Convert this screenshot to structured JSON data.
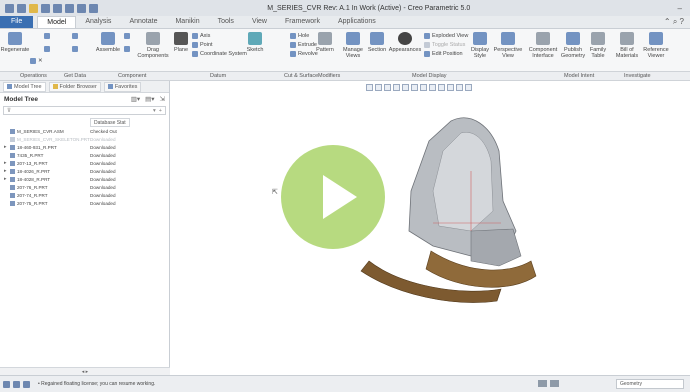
{
  "window": {
    "title": "M_SERIES_CVR Rev: A.1 In Work (Active) - Creo Parametric 5.0"
  },
  "tabs": [
    {
      "label": "File"
    },
    {
      "label": "Model"
    },
    {
      "label": "Analysis"
    },
    {
      "label": "Annotate"
    },
    {
      "label": "Manikin"
    },
    {
      "label": "Tools"
    },
    {
      "label": "View"
    },
    {
      "label": "Framework"
    },
    {
      "label": "Applications"
    }
  ],
  "ribbon": {
    "regenerate": "Regenerate",
    "assemble": "Assemble",
    "drag": "Drag Components",
    "plane": "Plane",
    "axis": "Axis",
    "point": "Point",
    "csys": "Coordinate System",
    "sketch": "Sketch",
    "hole": "Hole",
    "extrude": "Extrude",
    "revolve": "Revolve",
    "pattern": "Pattern",
    "manage_views": "Manage Views",
    "section": "Section",
    "appearances": "Appearances",
    "exploded_view": "Exploded View",
    "toggle_status": "Toggle Status",
    "edit_position": "Edit Position",
    "display_style": "Display Style",
    "perspective_view": "Perspective View",
    "component_interface": "Component Interface",
    "publish_geometry": "Publish Geometry",
    "family_table": "Family Table",
    "bill_of_materials": "Bill of Materials",
    "reference_viewer": "Reference Viewer"
  },
  "groups": {
    "operations": "Operations",
    "get_data": "Get Data",
    "component": "Component",
    "datum": "Datum",
    "cut_surface": "Cut & Surface",
    "modifiers": "Modifiers",
    "model_display": "Model Display",
    "model_intent": "Model Intent",
    "investigate": "Investigate"
  },
  "panel": {
    "tabs": [
      {
        "label": "Model Tree"
      },
      {
        "label": "Folder Browser"
      },
      {
        "label": "Favorites"
      }
    ],
    "title": "Model Tree",
    "column": "Database Stat",
    "rows": [
      {
        "name": "M_SERIES_CVR.ASM",
        "status": "Checked Out",
        "dim": false,
        "arrow": ""
      },
      {
        "name": "M_SERIES_CVR_SKELETON.PRT",
        "status": "Downloaded",
        "dim": true,
        "arrow": ""
      },
      {
        "name": "18-460-931_R.PRT",
        "status": "Downloaded",
        "dim": false,
        "arrow": "▸"
      },
      {
        "name": "7435_R.PRT",
        "status": "Downloaded",
        "dim": false,
        "arrow": ""
      },
      {
        "name": "207-13_R.PRT",
        "status": "Downloaded",
        "dim": false,
        "arrow": "▸"
      },
      {
        "name": "18-4026_R.PRT",
        "status": "Downloaded",
        "dim": false,
        "arrow": "▸"
      },
      {
        "name": "18-4028_R.PRT",
        "status": "Downloaded",
        "dim": false,
        "arrow": "▸"
      },
      {
        "name": "207-76_R.PRT",
        "status": "Downloaded",
        "dim": false,
        "arrow": ""
      },
      {
        "name": "207-74_R.PRT",
        "status": "Downloaded",
        "dim": false,
        "arrow": ""
      },
      {
        "name": "207-75_R.PRT",
        "status": "Downloaded",
        "dim": false,
        "arrow": ""
      }
    ]
  },
  "status": {
    "message": "• Regained floating license; you can resume working.",
    "filter": "Geometry"
  }
}
